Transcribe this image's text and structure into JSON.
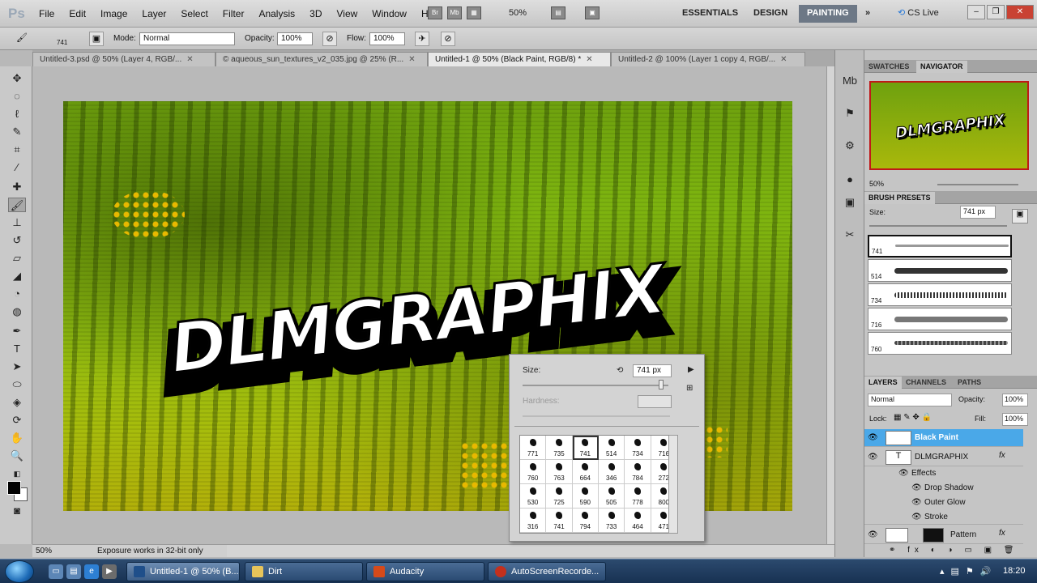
{
  "app": {
    "logo": "Ps"
  },
  "menu": [
    "File",
    "Edit",
    "Image",
    "Layer",
    "Select",
    "Filter",
    "Analysis",
    "3D",
    "View",
    "Window",
    "Help"
  ],
  "menubar_icons": {
    "br": "Br",
    "mb": "Mb",
    "zoom": "50%"
  },
  "workspaces": {
    "essentials": "ESSENTIALS",
    "design": "DESIGN",
    "painting": "PAINTING",
    "more": "»",
    "cslive": "CS Live"
  },
  "options": {
    "brush_size": "741",
    "mode_label": "Mode:",
    "mode_value": "Normal",
    "opacity_label": "Opacity:",
    "opacity_value": "100%",
    "flow_label": "Flow:",
    "flow_value": "100%"
  },
  "tabs": [
    {
      "label": "Untitled-3.psd @ 50% (Layer 4, RGB/..."
    },
    {
      "label": "© aqueous_sun_textures_v2_035.jpg @ 25% (R..."
    },
    {
      "label": "Untitled-1 @ 50% (Black Paint, RGB/8) *"
    },
    {
      "label": "Untitled-2 @ 100% (Layer 1 copy 4, RGB/..."
    }
  ],
  "canvas": {
    "logo_text": "DLMGRAPHIX"
  },
  "status": {
    "zoom": "50%",
    "message": "Exposure works in 32-bit only"
  },
  "brush_picker": {
    "size_label": "Size:",
    "size_value": "741 px",
    "hardness_label": "Hardness:",
    "brushes": [
      "771",
      "735",
      "741",
      "514",
      "734",
      "716",
      "760",
      "763",
      "664",
      "346",
      "784",
      "272",
      "530",
      "725",
      "590",
      "505",
      "778",
      "800",
      "316",
      "741",
      "794",
      "733",
      "464",
      "471"
    ]
  },
  "navigator": {
    "tab_swatches": "SWATCHES",
    "tab_navigator": "NAVIGATOR",
    "thumb_text": "DLMGRAPHIX",
    "zoom": "50%"
  },
  "brush_presets": {
    "title": "BRUSH PRESETS",
    "size_label": "Size:",
    "size_value": "741 px",
    "rows": [
      "741",
      "514",
      "734",
      "716",
      "760"
    ]
  },
  "layers": {
    "tab_layers": "LAYERS",
    "tab_channels": "CHANNELS",
    "tab_paths": "PATHS",
    "blend": "Normal",
    "opacity_label": "Opacity:",
    "opacity_value": "100%",
    "lock_label": "Lock:",
    "fill_label": "Fill:",
    "fill_value": "100%",
    "items": [
      {
        "name": "Black Paint"
      },
      {
        "name": "DLMGRAPHIX"
      },
      {
        "name": "Effects"
      },
      {
        "name": "Drop Shadow"
      },
      {
        "name": "Outer Glow"
      },
      {
        "name": "Stroke"
      },
      {
        "name": "Pattern"
      }
    ]
  },
  "taskbar": {
    "items": [
      {
        "label": "Untitled-1 @ 50% (B..."
      },
      {
        "label": "Dirt"
      },
      {
        "label": "Audacity"
      },
      {
        "label": "AutoScreenRecorde..."
      }
    ],
    "clock": "18:20"
  }
}
